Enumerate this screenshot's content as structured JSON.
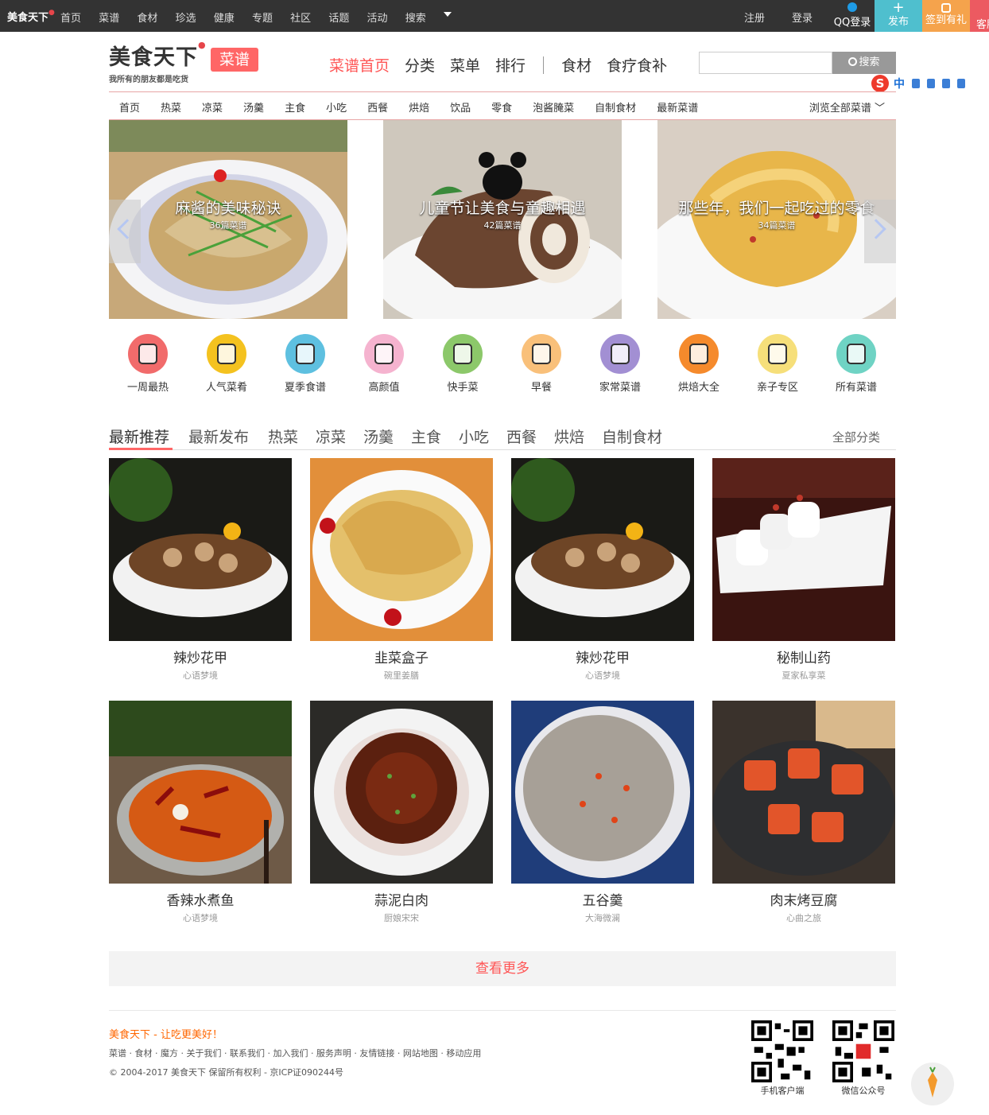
{
  "topbar": {
    "brand": "美食天下",
    "nav": [
      "首页",
      "菜谱",
      "食材",
      "珍选",
      "健康",
      "专题",
      "社区",
      "话题",
      "活动",
      "搜索"
    ],
    "register": "注册",
    "login": "登录",
    "qq_login": "QQ登录",
    "publish": "发布",
    "signin_gift": "签到有礼",
    "service": "客服"
  },
  "header": {
    "logo_text": "美食天下",
    "slogan": "我所有的朋友都是吃货",
    "section_tag": "菜谱",
    "nav": [
      {
        "label": "菜谱首页",
        "active": true
      },
      {
        "label": "分类",
        "active": false
      },
      {
        "label": "菜单",
        "active": false
      },
      {
        "label": "排行",
        "active": false
      }
    ],
    "nav2": [
      "食材",
      "食疗食补"
    ],
    "search": {
      "value": "",
      "button": "搜索"
    },
    "ime": {
      "lang": "中"
    }
  },
  "subnav": {
    "items": [
      "首页",
      "热菜",
      "凉菜",
      "汤羹",
      "主食",
      "小吃",
      "西餐",
      "烘焙",
      "饮品",
      "零食",
      "泡酱腌菜",
      "自制食材",
      "最新菜谱"
    ],
    "browse_all": "浏览全部菜谱"
  },
  "banner": [
    {
      "title": "麻酱的美味秘诀",
      "count": "36篇菜谱"
    },
    {
      "title": "儿童节让美食与童趣相遇",
      "count": "42篇菜谱"
    },
    {
      "title": "那些年，我们一起吃过的零食",
      "count": "34篇菜谱"
    }
  ],
  "quick_icons": [
    {
      "label": "一周最热",
      "icon": "calendar-icon",
      "color": "#f16b6b"
    },
    {
      "label": "人气菜肴",
      "icon": "thumbs-up-icon",
      "color": "#f4c21f"
    },
    {
      "label": "夏季食谱",
      "icon": "umbrella-icon",
      "color": "#5ec0e0"
    },
    {
      "label": "高颜值",
      "icon": "flower-icon",
      "color": "#f5b3cf"
    },
    {
      "label": "快手菜",
      "icon": "hourglass-icon",
      "color": "#8cc86a"
    },
    {
      "label": "早餐",
      "icon": "milk-icon",
      "color": "#f9c07a"
    },
    {
      "label": "家常菜谱",
      "icon": "roast-chicken-icon",
      "color": "#a28fd3"
    },
    {
      "label": "烘焙大全",
      "icon": "cupcake-icon",
      "color": "#f58a2c"
    },
    {
      "label": "亲子专区",
      "icon": "baby-icon",
      "color": "#f6df7a"
    },
    {
      "label": "所有菜谱",
      "icon": "clipboard-icon",
      "color": "#6fd3c4"
    }
  ],
  "tabs": {
    "items": [
      "最新推荐",
      "最新发布",
      "热菜",
      "凉菜",
      "汤羹",
      "主食",
      "小吃",
      "西餐",
      "烘焙",
      "自制食材"
    ],
    "active_index": 0,
    "all_categories": "全部分类"
  },
  "recipes": [
    {
      "name": "辣炒花甲",
      "author": "心语梦境"
    },
    {
      "name": "韭菜盒子",
      "author": "碗里姜膳"
    },
    {
      "name": "辣炒花甲",
      "author": "心语梦境"
    },
    {
      "name": "秘制山药",
      "author": "夏家私享菜"
    },
    {
      "name": "香辣水煮鱼",
      "author": "心语梦境"
    },
    {
      "name": "蒜泥白肉",
      "author": "厨娘宋宋"
    },
    {
      "name": "五谷羹",
      "author": "大海微澜"
    },
    {
      "name": "肉末烤豆腐",
      "author": "心曲之旅"
    }
  ],
  "more_button": "查看更多",
  "footer": {
    "slogan": "美食天下 - 让吃更美好！",
    "links": "菜谱 · 食材 · 魔方 · 关于我们 · 联系我们 · 加入我们 · 服务声明 · 友情链接 · 网站地图 · 移动应用",
    "copyright": "© 2004-2017 美食天下 保留所有权利 - 京ICP证090244号",
    "qr": [
      {
        "label": "手机客户端"
      },
      {
        "label": "微信公众号"
      }
    ]
  }
}
